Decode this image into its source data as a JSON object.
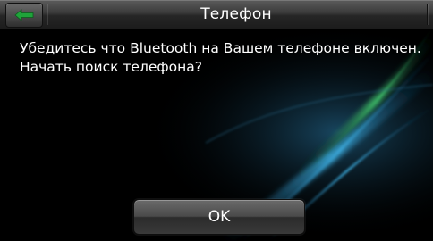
{
  "header": {
    "title": "Телефон",
    "back_icon": "back-arrow-icon",
    "accent_color": "#1fa33a"
  },
  "dialog": {
    "line1": "Убедитесь что Bluetooth на Вашем телефоне включен.",
    "line2": "Начать поиск телефона?",
    "ok_label": "OK"
  }
}
